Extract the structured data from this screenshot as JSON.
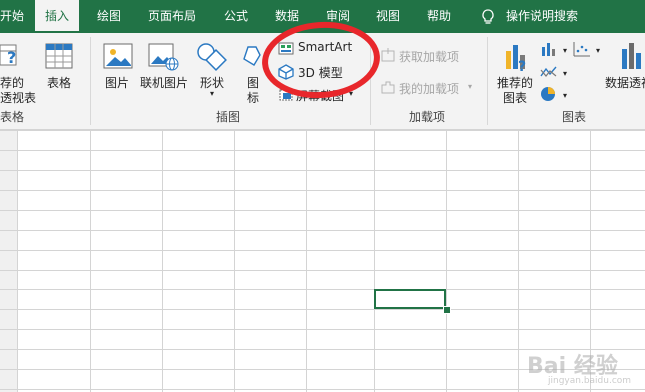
{
  "tabs": {
    "kaishi": "开始",
    "insert": "插入",
    "draw": "绘图",
    "layout": "页面布局",
    "formula": "公式",
    "data": "数据",
    "review": "审阅",
    "view": "视图",
    "help": "帮助",
    "search": "操作说明搜索"
  },
  "ribbon": {
    "pivot_line1": "荐的",
    "pivot_line2": "透视表",
    "table": "表格",
    "picture": "图片",
    "online_picture": "联机图片",
    "shapes": "形状",
    "icons_line1": "图",
    "icons_line2": "标",
    "smartart": "SmartArt",
    "model3d": "3D 模型",
    "screenshot": "屏幕截图",
    "get_addins": "获取加载项",
    "my_addins": "我的加载项",
    "rec_chart_line1": "推荐的",
    "rec_chart_line2": "图表",
    "pivot_chart": "数据透视"
  },
  "groups": {
    "tables": "表格",
    "illustrations": "插图",
    "addins": "加载项",
    "charts": "图表"
  },
  "colors": {
    "brand": "#217346",
    "annotation": "#e8272b"
  },
  "watermark": {
    "main": "Bai 经验",
    "sub": "jingyan.baidu.com"
  }
}
